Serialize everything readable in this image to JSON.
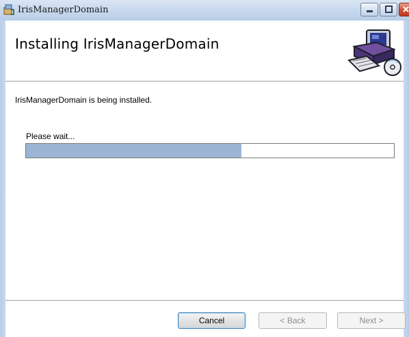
{
  "window": {
    "title": "IrisManagerDomain"
  },
  "header": {
    "title": "Installing IrisManagerDomain"
  },
  "main": {
    "status": "IrisManagerDomain is being installed.",
    "wait_label": "Please wait...",
    "progress_fraction": 0.585
  },
  "footer": {
    "cancel_label": "Cancel",
    "back_label": "< Back",
    "next_label": "Next >"
  },
  "colors": {
    "progress_fill": "#9db5d4",
    "titlebar": "#c8d9ee"
  },
  "icons": {
    "app": "installer-icon",
    "banner": "computer-setup-icon"
  }
}
